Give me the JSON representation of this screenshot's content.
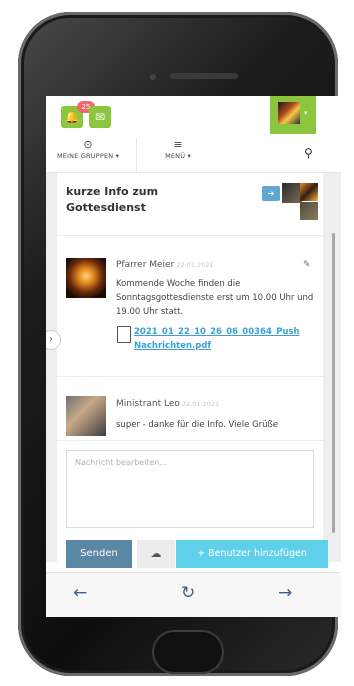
{
  "notifications": {
    "count": "25",
    "bell_icon": "bell-icon",
    "mail_icon": "mail-icon"
  },
  "nav": {
    "groups_label": "MEINE GRUPPEN ▾",
    "menu_label": "MENÜ ▾",
    "groups_icon": "target-icon",
    "menu_icon": "hamburger-icon",
    "search_icon": "search-icon"
  },
  "chat": {
    "title": "kurze Info zum Gottesdienst",
    "messages": [
      {
        "author": "Pfarrer Meier",
        "date": "22.01.2021",
        "text": "Kommende Woche finden die Sonntagsgottesdienste erst um 10.00 Uhr und 19.00 Uhr statt.",
        "attachment": "2021_01_22_10_26_06_00364_Push Nachrichten.pdf"
      },
      {
        "author": "Ministrant Leo",
        "date": "22.01.2021",
        "text": "super - danke für die Info. Viele Grüße"
      }
    ],
    "input_placeholder": "Nachricht bearbeiten...",
    "send_label": "Senden",
    "add_user_label": "+ Benutzer hinzufügen"
  },
  "colors": {
    "accent_green": "#8cc63f",
    "link_blue": "#3aa0d6",
    "send_blue": "#5a87a3",
    "add_cyan": "#5fd0ea"
  },
  "bottom_nav": {
    "back": "←",
    "reload": "↻",
    "forward": "→"
  }
}
